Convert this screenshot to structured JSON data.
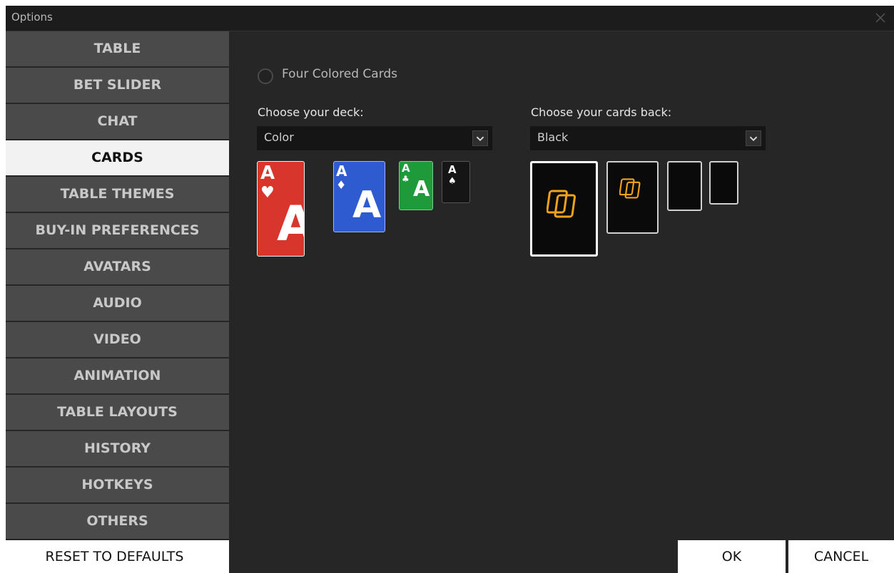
{
  "window": {
    "title": "Options"
  },
  "sidebar": {
    "items": [
      {
        "label": "TABLE"
      },
      {
        "label": "BET SLIDER"
      },
      {
        "label": "CHAT"
      },
      {
        "label": "CARDS",
        "active": true
      },
      {
        "label": "TABLE THEMES"
      },
      {
        "label": "BUY-IN PREFERENCES"
      },
      {
        "label": "AVATARS"
      },
      {
        "label": "AUDIO"
      },
      {
        "label": "VIDEO"
      },
      {
        "label": "ANIMATION"
      },
      {
        "label": "TABLE LAYOUTS"
      },
      {
        "label": "HISTORY"
      },
      {
        "label": "HOTKEYS"
      },
      {
        "label": "OTHERS"
      }
    ]
  },
  "cards": {
    "four_colored_label": "Four Colored Cards",
    "four_colored_checked": false,
    "deck_label": "Choose your deck:",
    "deck_value": "Color",
    "back_label": "Choose your cards back:",
    "back_value": "Black",
    "deck_preview": [
      {
        "rank": "A",
        "suit": "♥",
        "color": "#d8352c"
      },
      {
        "rank": "A",
        "suit": "♦",
        "color": "#2f5bd0"
      },
      {
        "rank": "A",
        "suit": "♣",
        "color": "#1f9a3a"
      },
      {
        "rank": "A",
        "suit": "♠",
        "color": "#151515"
      }
    ],
    "back_preview_logo_color": "#f0a21a"
  },
  "footer": {
    "reset_label": "RESET TO DEFAULTS",
    "ok_label": "OK",
    "cancel_label": "CANCEL"
  }
}
